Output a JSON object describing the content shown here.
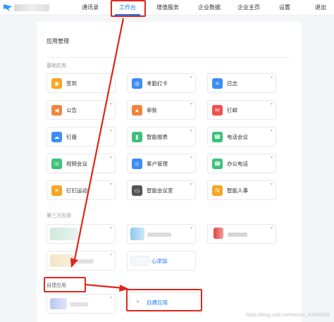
{
  "nav": {
    "items": [
      {
        "label": "通讯录"
      },
      {
        "label": "工作台"
      },
      {
        "label": "增值服务"
      },
      {
        "label": "企业数据"
      },
      {
        "label": "企业主页"
      },
      {
        "label": "设置"
      },
      {
        "label": "退出"
      }
    ],
    "active": "工作台"
  },
  "panel": {
    "title": "应用管理",
    "sections": {
      "basic": "基础应用",
      "third_party": "第三方应用",
      "self_built": "自建应用"
    }
  },
  "basic_apps": [
    {
      "label": "签到",
      "icon": "location-icon",
      "color": "#f5a623"
    },
    {
      "label": "考勤打卡",
      "icon": "pin-icon",
      "color": "#3d8df5"
    },
    {
      "label": "日志",
      "icon": "doc-icon",
      "color": "#3d8df5"
    },
    {
      "label": "公告",
      "icon": "megaphone-icon",
      "color": "#f5833d"
    },
    {
      "label": "审批",
      "icon": "stamp-icon",
      "color": "#f5833d"
    },
    {
      "label": "钉邮",
      "icon": "mail-icon",
      "color": "#f2504b"
    },
    {
      "label": "钉盘",
      "icon": "cloud-icon",
      "color": "#3d8df5"
    },
    {
      "label": "智能报表",
      "icon": "chart-icon",
      "color": "#3ac17a"
    },
    {
      "label": "电话会议",
      "icon": "phone-conf-icon",
      "color": "#3ac17a"
    },
    {
      "label": "视频会议",
      "icon": "video-icon",
      "color": "#3ac17a"
    },
    {
      "label": "客户管理",
      "icon": "customer-icon",
      "color": "#3d8df5"
    },
    {
      "label": "办公电话",
      "icon": "phone-icon",
      "color": "#3ac17a"
    },
    {
      "label": "钉钉运动",
      "icon": "run-icon",
      "color": "#f5a623"
    },
    {
      "label": "智能会议室",
      "icon": "screen-icon",
      "color": "#555555"
    },
    {
      "label": "智能人事",
      "icon": "hr-icon",
      "color": "#f5a623"
    }
  ],
  "third_party_partial_label": "心添加",
  "self_built_add_label": "自建应用",
  "watermark": "https://blog.csdn.net/weixin_43420032",
  "colors": {
    "accent": "#1677ff",
    "annotation": "#e1251b"
  }
}
